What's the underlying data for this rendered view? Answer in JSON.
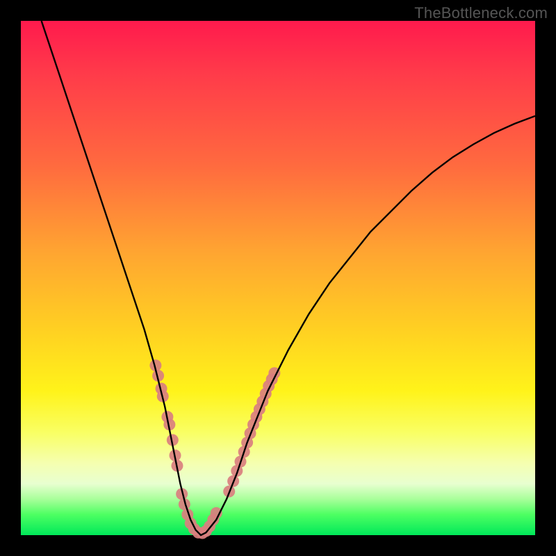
{
  "watermark": "TheBottleneck.com",
  "chart_data": {
    "type": "line",
    "title": "",
    "xlabel": "",
    "ylabel": "",
    "xlim": [
      0,
      100
    ],
    "ylim": [
      0,
      100
    ],
    "series": [
      {
        "name": "bottleneck-curve",
        "x": [
          4,
          6,
          8,
          10,
          12,
          14,
          16,
          18,
          20,
          22,
          24,
          26,
          28,
          29,
          30,
          31,
          32,
          33,
          34,
          35,
          36,
          38,
          40,
          42,
          44,
          46,
          48,
          52,
          56,
          60,
          64,
          68,
          72,
          76,
          80,
          84,
          88,
          92,
          96,
          100
        ],
        "y": [
          100,
          94,
          88,
          82,
          76,
          70,
          64,
          58,
          52,
          46,
          40,
          33,
          25,
          20,
          15,
          10,
          6,
          3,
          1,
          0,
          0.5,
          3,
          7,
          12,
          18,
          23,
          28,
          36,
          43,
          49,
          54,
          59,
          63,
          67,
          70.5,
          73.5,
          76,
          78.2,
          80,
          81.5
        ]
      }
    ],
    "marker_clusters": [
      {
        "label": "left-branch-markers",
        "points": [
          {
            "x": 26.2,
            "y": 33
          },
          {
            "x": 26.7,
            "y": 31
          },
          {
            "x": 27.3,
            "y": 28.5
          },
          {
            "x": 27.6,
            "y": 27
          },
          {
            "x": 28.5,
            "y": 23
          },
          {
            "x": 28.9,
            "y": 21.5
          },
          {
            "x": 29.5,
            "y": 18.5
          },
          {
            "x": 30.0,
            "y": 15.5
          },
          {
            "x": 30.4,
            "y": 13.5
          }
        ]
      },
      {
        "label": "valley-markers",
        "points": [
          {
            "x": 31.3,
            "y": 8
          },
          {
            "x": 31.8,
            "y": 6
          },
          {
            "x": 32.4,
            "y": 4
          },
          {
            "x": 33.0,
            "y": 2.3
          },
          {
            "x": 33.7,
            "y": 1.2
          },
          {
            "x": 34.5,
            "y": 0.5
          },
          {
            "x": 35.3,
            "y": 0.4
          },
          {
            "x": 36.0,
            "y": 0.8
          },
          {
            "x": 36.7,
            "y": 1.7
          },
          {
            "x": 37.4,
            "y": 3
          },
          {
            "x": 38.0,
            "y": 4.3
          }
        ]
      },
      {
        "label": "right-branch-markers",
        "points": [
          {
            "x": 40.5,
            "y": 8.5
          },
          {
            "x": 41.3,
            "y": 10.5
          },
          {
            "x": 42.0,
            "y": 12.5
          },
          {
            "x": 42.7,
            "y": 14.3
          },
          {
            "x": 43.4,
            "y": 16.2
          },
          {
            "x": 44.0,
            "y": 18
          },
          {
            "x": 44.6,
            "y": 19.8
          },
          {
            "x": 45.2,
            "y": 21.5
          },
          {
            "x": 45.8,
            "y": 23
          },
          {
            "x": 46.4,
            "y": 24.5
          },
          {
            "x": 47.0,
            "y": 26
          },
          {
            "x": 47.6,
            "y": 27.5
          },
          {
            "x": 48.2,
            "y": 29
          },
          {
            "x": 48.8,
            "y": 30.3
          },
          {
            "x": 49.3,
            "y": 31.5
          }
        ]
      }
    ],
    "colors": {
      "curve": "#000000",
      "markers": "#d97f7f"
    }
  }
}
